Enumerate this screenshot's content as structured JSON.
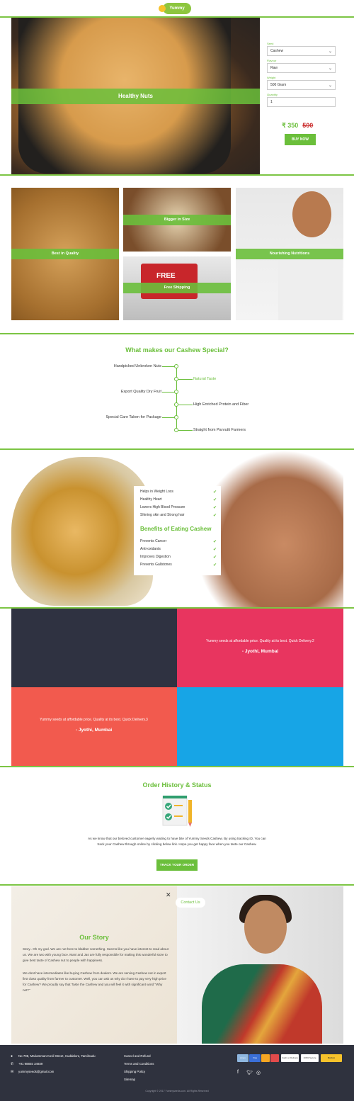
{
  "brand": {
    "logo_text": "Yummy SEEDS"
  },
  "hero": {
    "banner": "Healthy Nuts",
    "fields": [
      {
        "label": "Seed",
        "value": "Cashew"
      },
      {
        "label": "Flavour",
        "value": "Raw"
      },
      {
        "label": "Weight",
        "value": "500 Gram"
      },
      {
        "label": "Quantity",
        "value": "1"
      }
    ],
    "price": "₹ 350",
    "old_price": "500",
    "buy_label": "BUY NOW"
  },
  "features": [
    "Best in Quality",
    "Bigger in Size",
    "Free Shipping",
    "Nourishing Nutritions"
  ],
  "truck_text": "FREE",
  "special": {
    "title": "What makes our Cashew Special?",
    "left": [
      "Handpicked Unbroken Nuts",
      "Export Quality Dry Fruit",
      "Special Care Taken for Package"
    ],
    "right": [
      "Natural Taste",
      "High Enriched Protein and Fiber",
      "Straight from Panrutti Farmers"
    ]
  },
  "benefits": {
    "title": "Benefits of Eating Cashew",
    "top": [
      "Helps in Weight Loss",
      "Healthy Heart",
      "Lowers High Blood Pressure",
      "Shining skin and Strong hair"
    ],
    "bottom": [
      "Prevents Cancer",
      "Anti-oxidants",
      "Improves Digestion",
      "Prevents Gallstones"
    ]
  },
  "testimonials": [
    {
      "text": "Yummy seeds at affordable price. Quality at its best. Quick Delivery.2",
      "author": "- Jyothi, Mumbai"
    },
    {
      "text": "Yummy seeds at affordable price. Quality at its best. Quick Delivery.3",
      "author": "- Jyothi, Mumbai"
    }
  ],
  "colors": {
    "accent": "#6bbf3b",
    "tile_dark": "#2f3241",
    "tile_pink": "#e8355f",
    "tile_coral": "#f25a4e",
    "tile_blue": "#17a5e6",
    "footer": "#2f323e"
  },
  "order": {
    "title": "Order History & Status",
    "text": "As we know that our beloved customer eagerly waiting to have bite of Yummy Seeds Cashew. By using tracking ID, You can track your Cashew through online by clicking below link. Hope you get happy face when you taste our Cashew.",
    "button": "TRACK YOUR ORDER"
  },
  "story": {
    "close": "✕",
    "contact": "Contact Us",
    "title": "Our Story",
    "p1": "Story.. Oh my god. We are not here to blabber something. Seems like you have interest to read about us. We are two with young face. Mani and Jas are fully responsible for making this wonderful store to give best taste of Cashew nut to people with happiness.",
    "p2": "We dont have intermediates like buying Cashew from dealers. We are serving Cashew nut in export first class quality from farmer to customer. Well, you can ask us why do I have to pay very high price for Cashew? We proudly say that Taste the Cashew and you will feel it with significant word \"Why not?\""
  },
  "footer": {
    "address": "No 708, Mariamman Kovil Street, Cuddalore, Tamilnadu",
    "phone": "+91 98845 34939",
    "email": "yummyseeds@gmail.com",
    "links": [
      "Cancel and Refund",
      "Terms and Conditions",
      "Shipping Policy",
      "Sitemap"
    ],
    "badges": [
      "Amex",
      "Visa",
      "",
      "",
      "Cash on Delivery",
      "100% Secure",
      "Norton"
    ],
    "copyright": "Copyright © 2017 Yummyseeds.com. All Rights Reserved"
  }
}
